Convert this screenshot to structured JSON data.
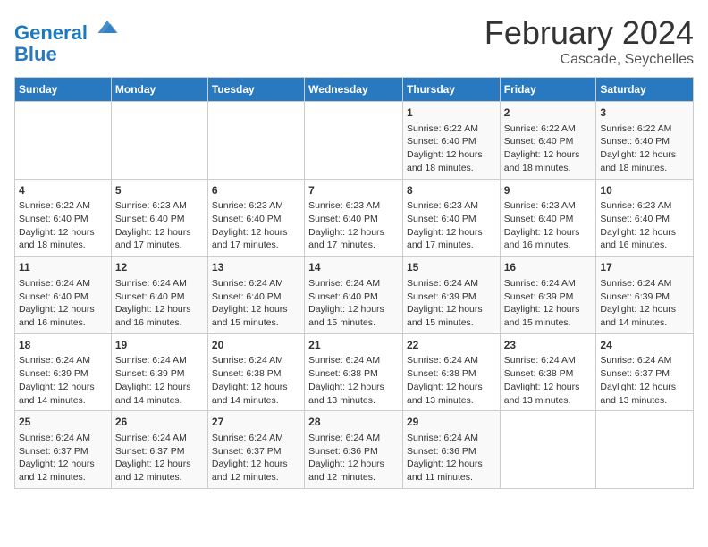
{
  "header": {
    "logo_line1": "General",
    "logo_line2": "Blue",
    "title": "February 2024",
    "subtitle": "Cascade, Seychelles"
  },
  "days_of_week": [
    "Sunday",
    "Monday",
    "Tuesday",
    "Wednesday",
    "Thursday",
    "Friday",
    "Saturday"
  ],
  "weeks": [
    [
      {
        "day": "",
        "info": ""
      },
      {
        "day": "",
        "info": ""
      },
      {
        "day": "",
        "info": ""
      },
      {
        "day": "",
        "info": ""
      },
      {
        "day": "1",
        "info": "Sunrise: 6:22 AM\nSunset: 6:40 PM\nDaylight: 12 hours and 18 minutes."
      },
      {
        "day": "2",
        "info": "Sunrise: 6:22 AM\nSunset: 6:40 PM\nDaylight: 12 hours and 18 minutes."
      },
      {
        "day": "3",
        "info": "Sunrise: 6:22 AM\nSunset: 6:40 PM\nDaylight: 12 hours and 18 minutes."
      }
    ],
    [
      {
        "day": "4",
        "info": "Sunrise: 6:22 AM\nSunset: 6:40 PM\nDaylight: 12 hours and 18 minutes."
      },
      {
        "day": "5",
        "info": "Sunrise: 6:23 AM\nSunset: 6:40 PM\nDaylight: 12 hours and 17 minutes."
      },
      {
        "day": "6",
        "info": "Sunrise: 6:23 AM\nSunset: 6:40 PM\nDaylight: 12 hours and 17 minutes."
      },
      {
        "day": "7",
        "info": "Sunrise: 6:23 AM\nSunset: 6:40 PM\nDaylight: 12 hours and 17 minutes."
      },
      {
        "day": "8",
        "info": "Sunrise: 6:23 AM\nSunset: 6:40 PM\nDaylight: 12 hours and 17 minutes."
      },
      {
        "day": "9",
        "info": "Sunrise: 6:23 AM\nSunset: 6:40 PM\nDaylight: 12 hours and 16 minutes."
      },
      {
        "day": "10",
        "info": "Sunrise: 6:23 AM\nSunset: 6:40 PM\nDaylight: 12 hours and 16 minutes."
      }
    ],
    [
      {
        "day": "11",
        "info": "Sunrise: 6:24 AM\nSunset: 6:40 PM\nDaylight: 12 hours and 16 minutes."
      },
      {
        "day": "12",
        "info": "Sunrise: 6:24 AM\nSunset: 6:40 PM\nDaylight: 12 hours and 16 minutes."
      },
      {
        "day": "13",
        "info": "Sunrise: 6:24 AM\nSunset: 6:40 PM\nDaylight: 12 hours and 15 minutes."
      },
      {
        "day": "14",
        "info": "Sunrise: 6:24 AM\nSunset: 6:40 PM\nDaylight: 12 hours and 15 minutes."
      },
      {
        "day": "15",
        "info": "Sunrise: 6:24 AM\nSunset: 6:39 PM\nDaylight: 12 hours and 15 minutes."
      },
      {
        "day": "16",
        "info": "Sunrise: 6:24 AM\nSunset: 6:39 PM\nDaylight: 12 hours and 15 minutes."
      },
      {
        "day": "17",
        "info": "Sunrise: 6:24 AM\nSunset: 6:39 PM\nDaylight: 12 hours and 14 minutes."
      }
    ],
    [
      {
        "day": "18",
        "info": "Sunrise: 6:24 AM\nSunset: 6:39 PM\nDaylight: 12 hours and 14 minutes."
      },
      {
        "day": "19",
        "info": "Sunrise: 6:24 AM\nSunset: 6:39 PM\nDaylight: 12 hours and 14 minutes."
      },
      {
        "day": "20",
        "info": "Sunrise: 6:24 AM\nSunset: 6:38 PM\nDaylight: 12 hours and 14 minutes."
      },
      {
        "day": "21",
        "info": "Sunrise: 6:24 AM\nSunset: 6:38 PM\nDaylight: 12 hours and 13 minutes."
      },
      {
        "day": "22",
        "info": "Sunrise: 6:24 AM\nSunset: 6:38 PM\nDaylight: 12 hours and 13 minutes."
      },
      {
        "day": "23",
        "info": "Sunrise: 6:24 AM\nSunset: 6:38 PM\nDaylight: 12 hours and 13 minutes."
      },
      {
        "day": "24",
        "info": "Sunrise: 6:24 AM\nSunset: 6:37 PM\nDaylight: 12 hours and 13 minutes."
      }
    ],
    [
      {
        "day": "25",
        "info": "Sunrise: 6:24 AM\nSunset: 6:37 PM\nDaylight: 12 hours and 12 minutes."
      },
      {
        "day": "26",
        "info": "Sunrise: 6:24 AM\nSunset: 6:37 PM\nDaylight: 12 hours and 12 minutes."
      },
      {
        "day": "27",
        "info": "Sunrise: 6:24 AM\nSunset: 6:37 PM\nDaylight: 12 hours and 12 minutes."
      },
      {
        "day": "28",
        "info": "Sunrise: 6:24 AM\nSunset: 6:36 PM\nDaylight: 12 hours and 12 minutes."
      },
      {
        "day": "29",
        "info": "Sunrise: 6:24 AM\nSunset: 6:36 PM\nDaylight: 12 hours and 11 minutes."
      },
      {
        "day": "",
        "info": ""
      },
      {
        "day": "",
        "info": ""
      }
    ]
  ]
}
